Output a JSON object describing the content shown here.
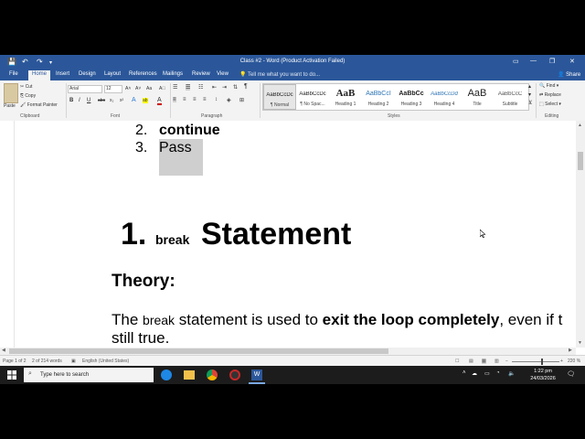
{
  "window": {
    "title": "Class #2 - Word (Product Activation Failed)",
    "qat_save": "💾",
    "qat_undo": "↶",
    "qat_redo": "↷",
    "qat_more": "▾",
    "ribbon_display": "▭",
    "minimize": "—",
    "maximize": "❐",
    "close": "✕"
  },
  "tabs": [
    "File",
    "Home",
    "Insert",
    "Design",
    "Layout",
    "References",
    "Mailings",
    "Review",
    "View"
  ],
  "tell_me": "Tell me what you want to do...",
  "share": "Share",
  "clipboard": {
    "paste": "Paste",
    "cut": "Cut",
    "copy": "Copy",
    "format_painter": "Format Painter",
    "label": "Clipboard"
  },
  "font": {
    "name": "Arial",
    "size": "12",
    "grow": "A˄",
    "shrink": "A˅",
    "case": "Aa",
    "clear": "A⃠",
    "bold": "B",
    "italic": "I",
    "underline": "U",
    "strike": "abc",
    "subscript": "x₂",
    "superscript": "x²",
    "text_effects": "A",
    "highlight": "ab",
    "font_color": "A",
    "label": "Font"
  },
  "paragraph": {
    "label": "Paragraph",
    "pilcrow": "¶"
  },
  "styles": {
    "label": "Styles",
    "items": [
      {
        "sample": "AaBbCcDc",
        "name": "¶ Normal"
      },
      {
        "sample": "AaBbCcDc",
        "name": "¶ No Spac..."
      },
      {
        "sample": "AaB",
        "name": "Heading 1"
      },
      {
        "sample": "AaBbCcI",
        "name": "Heading 2"
      },
      {
        "sample": "AaBbCc",
        "name": "Heading 3"
      },
      {
        "sample": "AaBbCcDd",
        "name": "Heading 4"
      },
      {
        "sample": "AaB",
        "name": "Title"
      },
      {
        "sample": "AaBbCcC",
        "name": "Subtitle"
      }
    ]
  },
  "editing": {
    "find": "Find ▾",
    "replace": "Replace",
    "select": "Select ▾",
    "label": "Editing"
  },
  "document": {
    "list_2_num": "2.",
    "list_2_text": "continue",
    "list_3_num": "3.",
    "list_3_text": "Pass",
    "heading_num": "1.",
    "heading_code": "break",
    "heading_text": "Statement",
    "theory": "Theory:",
    "para1_a": "The ",
    "para1_code": "break",
    "para1_b": " statement is used to ",
    "para1_bold": "exit the loop completely",
    "para1_c": ", even if t",
    "para2": "still true."
  },
  "status": {
    "page": "Page 1 of 2",
    "words": "2 of 214 words",
    "language": "English (United States)",
    "zoom": "220 %"
  },
  "taskbar": {
    "search_placeholder": "Type here to search",
    "time": "1:22 pm",
    "date": "24/03/2026"
  },
  "colors": {
    "word_blue": "#2b579a",
    "ribbon_bg": "#f3f3f3",
    "taskbar_bg": "#1c1c1c",
    "highlight_gray": "#cfcfcf"
  }
}
